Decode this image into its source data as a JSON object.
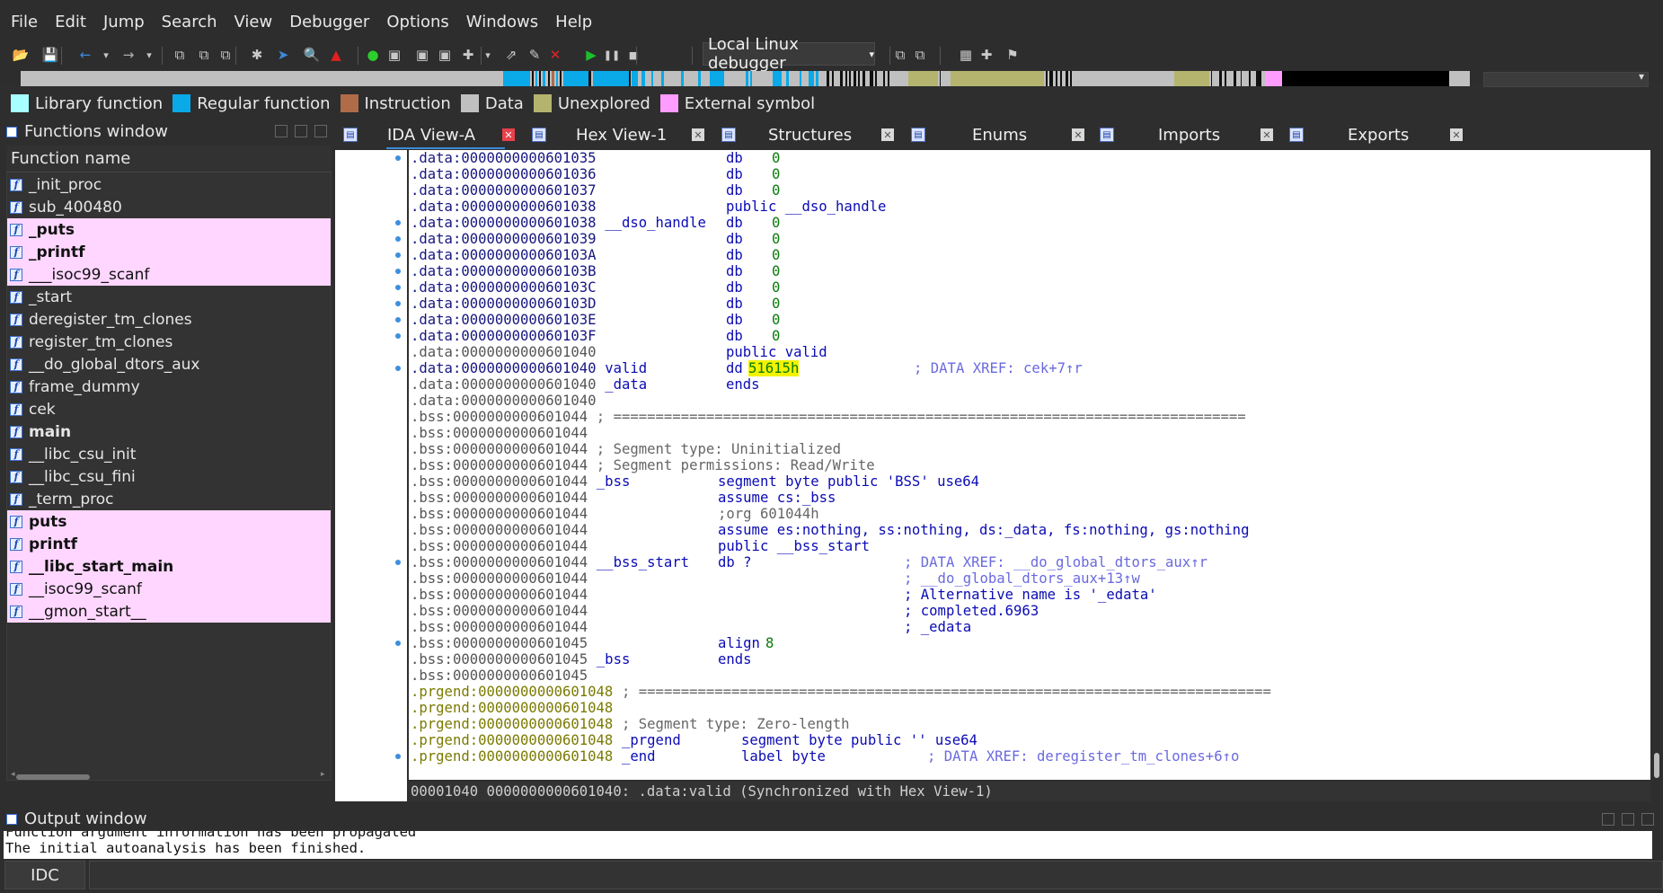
{
  "menu": [
    "File",
    "Edit",
    "Jump",
    "Search",
    "View",
    "Debugger",
    "Options",
    "Windows",
    "Help"
  ],
  "toolbar": {
    "debugger": "Local Linux debugger",
    "icons": [
      "open-icon",
      "save-icon",
      "back-icon",
      "back-dropdown-icon",
      "forward-icon",
      "forward-dropdown-icon",
      "xref-icon",
      "strings-icon",
      "names-icon",
      "patch-icon",
      "jump-icon",
      "search-icon",
      "graph-icon",
      "circle-icon",
      "code-icon",
      "data-icon",
      "string-icon",
      "run-to-icon",
      "dropdown-icon",
      "segment-icon",
      "edit-icon",
      "delete-icon",
      "play-icon",
      "pause-icon",
      "stop-icon",
      "attach-icon",
      "detach-icon",
      "breakpoints-icon",
      "trace-icon",
      "flag-icon"
    ]
  },
  "legend": [
    {
      "label": "Library function",
      "color": "#a8ffff"
    },
    {
      "label": "Regular function",
      "color": "#0aa9e8"
    },
    {
      "label": "Instruction",
      "color": "#b06b49"
    },
    {
      "label": "Data",
      "color": "#c0c0c0"
    },
    {
      "label": "Unexplored",
      "color": "#b4b46e"
    },
    {
      "label": "External symbol",
      "color": "#ff9cff"
    }
  ],
  "functions_window": {
    "title": "Functions window",
    "header": "Function name",
    "items": [
      {
        "name": "_init_proc",
        "external": false,
        "bold": false
      },
      {
        "name": "sub_400480",
        "external": false,
        "bold": false
      },
      {
        "name": "_puts",
        "external": true,
        "bold": true
      },
      {
        "name": "_printf",
        "external": true,
        "bold": true
      },
      {
        "name": "___isoc99_scanf",
        "external": true,
        "bold": false
      },
      {
        "name": "_start",
        "external": false,
        "bold": false
      },
      {
        "name": "deregister_tm_clones",
        "external": false,
        "bold": false
      },
      {
        "name": "register_tm_clones",
        "external": false,
        "bold": false
      },
      {
        "name": "__do_global_dtors_aux",
        "external": false,
        "bold": false
      },
      {
        "name": "frame_dummy",
        "external": false,
        "bold": false
      },
      {
        "name": "cek",
        "external": false,
        "bold": false
      },
      {
        "name": "main",
        "external": false,
        "bold": true
      },
      {
        "name": "__libc_csu_init",
        "external": false,
        "bold": false
      },
      {
        "name": "__libc_csu_fini",
        "external": false,
        "bold": false
      },
      {
        "name": "_term_proc",
        "external": false,
        "bold": false
      },
      {
        "name": "puts",
        "external": true,
        "bold": true
      },
      {
        "name": "printf",
        "external": true,
        "bold": true
      },
      {
        "name": "__libc_start_main",
        "external": true,
        "bold": true
      },
      {
        "name": "__isoc99_scanf",
        "external": true,
        "bold": false
      },
      {
        "name": "__gmon_start__",
        "external": true,
        "bold": false
      }
    ]
  },
  "tabs": [
    {
      "label": "IDA View-A",
      "active": true
    },
    {
      "label": "Hex View-1",
      "active": false
    },
    {
      "label": "Structures",
      "active": false
    },
    {
      "label": "Enums",
      "active": false
    },
    {
      "label": "Imports",
      "active": false
    },
    {
      "label": "Exports",
      "active": false
    }
  ],
  "disasm": [
    {
      "addr": ".data:0000000000601035",
      "label": "",
      "op": "db",
      "arg": "0",
      "cmt": "",
      "kind": "data",
      "dot": true
    },
    {
      "addr": ".data:0000000000601036",
      "label": "",
      "op": "db",
      "arg": "0",
      "cmt": "",
      "kind": "data",
      "dot": false
    },
    {
      "addr": ".data:0000000000601037",
      "label": "",
      "op": "db",
      "arg": "0",
      "cmt": "",
      "kind": "data",
      "dot": false
    },
    {
      "addr": ".data:0000000000601038",
      "label": "",
      "op": "public __dso_handle",
      "arg": "",
      "cmt": "",
      "kind": "data",
      "dot": false
    },
    {
      "addr": ".data:0000000000601038",
      "label": "__dso_handle",
      "op": "db",
      "arg": "0",
      "cmt": "",
      "kind": "data",
      "dot": true
    },
    {
      "addr": ".data:0000000000601039",
      "label": "",
      "op": "db",
      "arg": "0",
      "cmt": "",
      "kind": "data",
      "dot": true
    },
    {
      "addr": ".data:000000000060103A",
      "label": "",
      "op": "db",
      "arg": "0",
      "cmt": "",
      "kind": "data",
      "dot": true
    },
    {
      "addr": ".data:000000000060103B",
      "label": "",
      "op": "db",
      "arg": "0",
      "cmt": "",
      "kind": "data",
      "dot": true
    },
    {
      "addr": ".data:000000000060103C",
      "label": "",
      "op": "db",
      "arg": "0",
      "cmt": "",
      "kind": "data",
      "dot": true
    },
    {
      "addr": ".data:000000000060103D",
      "label": "",
      "op": "db",
      "arg": "0",
      "cmt": "",
      "kind": "data",
      "dot": true
    },
    {
      "addr": ".data:000000000060103E",
      "label": "",
      "op": "db",
      "arg": "0",
      "cmt": "",
      "kind": "data",
      "dot": true
    },
    {
      "addr": ".data:000000000060103F",
      "label": "",
      "op": "db",
      "arg": "0",
      "cmt": "",
      "kind": "data",
      "dot": true
    },
    {
      "addr": ".data:0000000000601040",
      "label": "",
      "op": "public valid",
      "arg": "",
      "cmt": "",
      "kind": "data-grey",
      "dot": false
    },
    {
      "addr": ".data:0000000000601040",
      "label": "valid",
      "op": "dd",
      "arg": "51615h",
      "cmt": "; DATA XREF: cek+7↑r",
      "kind": "data-hl",
      "dot": true
    },
    {
      "addr": ".data:0000000000601040",
      "label": "_data",
      "op": "ends",
      "arg": "",
      "cmt": "",
      "kind": "data-grey",
      "dot": false
    },
    {
      "addr": ".data:0000000000601040",
      "label": "",
      "op": "",
      "arg": "",
      "cmt": "",
      "kind": "data-grey",
      "dot": false
    },
    {
      "addr": ".bss:0000000000601044",
      "label": "",
      "op": "",
      "arg": "",
      "cmt": "; ===========================================================================",
      "kind": "bss",
      "dot": false
    },
    {
      "addr": ".bss:0000000000601044",
      "label": "",
      "op": "",
      "arg": "",
      "cmt": "",
      "kind": "bss",
      "dot": false
    },
    {
      "addr": ".bss:0000000000601044",
      "label": "",
      "op": "",
      "arg": "",
      "cmt": "; Segment type: Uninitialized",
      "kind": "bss",
      "dot": false
    },
    {
      "addr": ".bss:0000000000601044",
      "label": "",
      "op": "",
      "arg": "",
      "cmt": "; Segment permissions: Read/Write",
      "kind": "bss",
      "dot": false
    },
    {
      "addr": ".bss:0000000000601044",
      "label": "_bss",
      "op": "segment byte public 'BSS' use64",
      "arg": "",
      "cmt": "",
      "kind": "bss",
      "dot": false
    },
    {
      "addr": ".bss:0000000000601044",
      "label": "",
      "op": "assume cs:_bss",
      "arg": "",
      "cmt": "",
      "kind": "bss",
      "dot": false
    },
    {
      "addr": ".bss:0000000000601044",
      "label": "",
      "op": ";org 601044h",
      "arg": "",
      "cmt": "",
      "kind": "bss-org",
      "dot": false
    },
    {
      "addr": ".bss:0000000000601044",
      "label": "",
      "op": "assume es:nothing, ss:nothing, ds:_data, fs:nothing, gs:nothing",
      "arg": "",
      "cmt": "",
      "kind": "bss",
      "dot": false
    },
    {
      "addr": ".bss:0000000000601044",
      "label": "",
      "op": "public __bss_start",
      "arg": "",
      "cmt": "",
      "kind": "bss",
      "dot": false
    },
    {
      "addr": ".bss:0000000000601044",
      "label": "__bss_start",
      "op": "db ?",
      "arg": "",
      "cmt": "; DATA XREF: __do_global_dtors_aux↑r",
      "kind": "bss",
      "dot": true
    },
    {
      "addr": ".bss:0000000000601044",
      "label": "",
      "op": "",
      "arg": "",
      "cmt": "; __do_global_dtors_aux+13↑w",
      "kind": "bss",
      "dot": false
    },
    {
      "addr": ".bss:0000000000601044",
      "label": "",
      "op": "",
      "arg": "",
      "cmt": "; Alternative name is '_edata'",
      "kind": "bss-cmtdark",
      "dot": false
    },
    {
      "addr": ".bss:0000000000601044",
      "label": "",
      "op": "",
      "arg": "",
      "cmt": "; completed.6963",
      "kind": "bss-cmtdark",
      "dot": false
    },
    {
      "addr": ".bss:0000000000601044",
      "label": "",
      "op": "",
      "arg": "",
      "cmt": "; _edata",
      "kind": "bss-cmtdark",
      "dot": false
    },
    {
      "addr": ".bss:0000000000601045",
      "label": "",
      "op": "align",
      "arg": "8",
      "cmt": "",
      "kind": "bss",
      "dot": true
    },
    {
      "addr": ".bss:0000000000601045",
      "label": "_bss",
      "op": "ends",
      "arg": "",
      "cmt": "",
      "kind": "bss",
      "dot": false
    },
    {
      "addr": ".bss:0000000000601045",
      "label": "",
      "op": "",
      "arg": "",
      "cmt": "",
      "kind": "bss",
      "dot": false
    },
    {
      "addr": ".prgend:0000000000601048",
      "label": "",
      "op": "",
      "arg": "",
      "cmt": "; ===========================================================================",
      "kind": "prg",
      "dot": false
    },
    {
      "addr": ".prgend:0000000000601048",
      "label": "",
      "op": "",
      "arg": "",
      "cmt": "",
      "kind": "prg",
      "dot": false
    },
    {
      "addr": ".prgend:0000000000601048",
      "label": "",
      "op": "",
      "arg": "",
      "cmt": "; Segment type: Zero-length",
      "kind": "prg",
      "dot": false
    },
    {
      "addr": ".prgend:0000000000601048",
      "label": "_prgend",
      "op": "segment byte public '' use64",
      "arg": "",
      "cmt": "",
      "kind": "prg",
      "dot": false
    },
    {
      "addr": ".prgend:0000000000601048",
      "label": "_end",
      "op": "label byte",
      "arg": "",
      "cmt": "; DATA XREF: deregister_tm_clones+6↑o",
      "kind": "prg",
      "dot": true
    }
  ],
  "status_line": "00001040 0000000000601040: .data:valid (Synchronized with Hex View-1)",
  "output": {
    "title": "Output window",
    "lines": [
      "Function argument information has been propagated",
      "The initial autoanalysis has been finished."
    ],
    "idc_label": "IDC"
  }
}
